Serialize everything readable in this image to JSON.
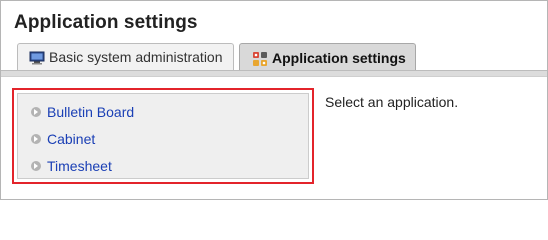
{
  "page": {
    "title": "Application settings"
  },
  "tabs": [
    {
      "label": "Basic system administration",
      "icon": "monitor-icon",
      "active": false
    },
    {
      "label": "Application settings",
      "icon": "apps-grid-icon",
      "active": true
    }
  ],
  "apps": [
    {
      "label": "Bulletin Board"
    },
    {
      "label": "Cabinet"
    },
    {
      "label": "Timesheet"
    }
  ],
  "hint": "Select an application.",
  "colors": {
    "highlight_border": "#e3242b",
    "link": "#1a3fb5",
    "active_tab": "#d9d9d9"
  }
}
